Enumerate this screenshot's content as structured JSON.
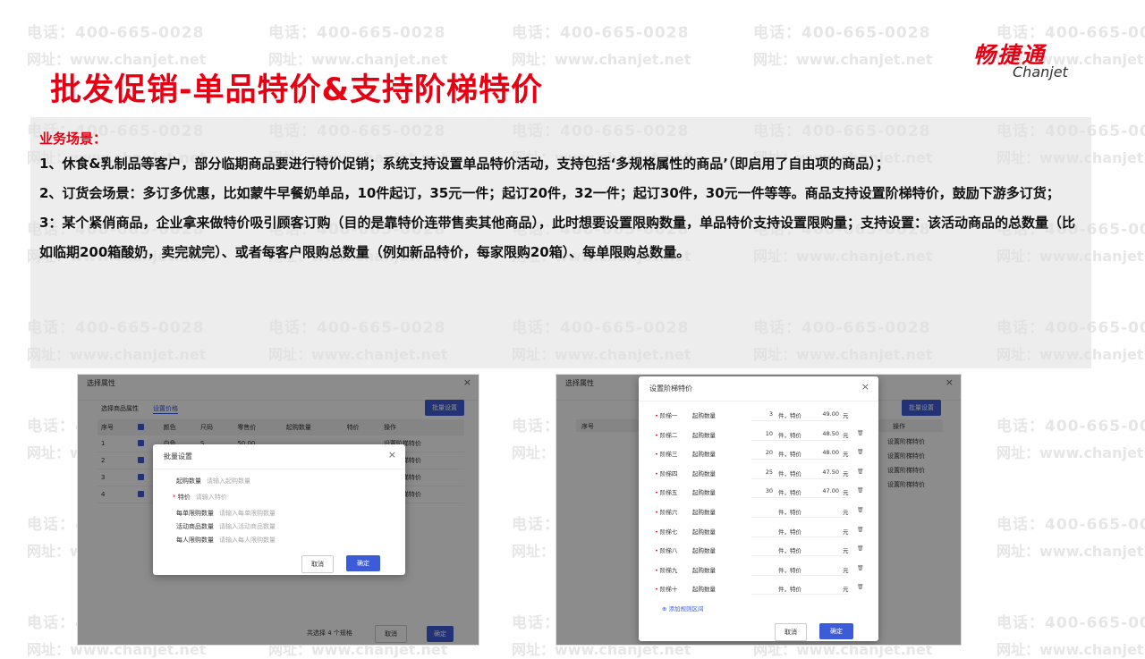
{
  "title": "批发促销-单品特价&支持阶梯特价",
  "logo": {
    "cn": "畅捷通",
    "en": "Chanjet"
  },
  "watermark": {
    "line1": "电话：400-665-0028",
    "line2": "网址：www.chanjet.net"
  },
  "scenario": {
    "heading": "业务场景：",
    "lines": [
      "1、休食&乳制品等客户，部分临期商品要进行特价促销；系统支持设置单品特价活动，支持包括‘多规格属性的商品’（即启用了自由项的商品）；",
      "2、订货会场景：多订多优惠，比如蒙牛早餐奶单品，10件起订，35元一件；起订20件，32一件；起订30件，30元一件等等。商品支持设置阶梯特价，鼓励下游多订货；",
      "3：某个紧俏商品，企业拿来做特价吸引顾客订购（目的是靠特价连带售卖其他商品），此时想要设置限购数量，单品特价支持设置限购量；支持设置：该活动商品的总数量（比如临期200箱酸奶，卖完就完）、或者每客户限购总数量（例如新品特价，每家限购20箱）、每单限购总数量。"
    ]
  },
  "left_screenshot": {
    "window_title": "选择属性",
    "tabs": [
      "选择商品属性",
      "设置价格"
    ],
    "batch_button": "批量设置",
    "columns": [
      "序号",
      "颜色",
      "尺码",
      "零售价",
      "起购数量",
      "特价",
      "操作"
    ],
    "rows": [
      {
        "no": "1",
        "color": "白色",
        "size": "S",
        "price": "50.00"
      },
      {
        "no": "2",
        "color": "",
        "size": "",
        "price": ""
      },
      {
        "no": "3",
        "color": "",
        "size": "",
        "price": ""
      },
      {
        "no": "4",
        "color": "",
        "size": "",
        "price": ""
      }
    ],
    "row_op": "设置阶梯特价",
    "footer_count": "共选择 4 个规格",
    "cancel": "取消",
    "confirm": "确定",
    "dialog": {
      "title": "批量设置",
      "fields": [
        {
          "label": "起购数量",
          "placeholder": "请输入起购数量",
          "required": false
        },
        {
          "label": "特价",
          "placeholder": "请输入特价",
          "required": true
        },
        {
          "label": "每单限购数量",
          "placeholder": "请输入每单限购数量",
          "required": false
        },
        {
          "label": "活动商品数量",
          "placeholder": "请输入活动商品数量",
          "required": false
        },
        {
          "label": "每人限购数量",
          "placeholder": "请输入每人限购数量",
          "required": false
        }
      ],
      "cancel": "取消",
      "confirm": "确定"
    }
  },
  "right_screenshot": {
    "window_title": "选择属性",
    "batch_button": "批量设置",
    "columns": [
      "序号",
      "操作"
    ],
    "row_op": "设置阶梯特价",
    "dialog": {
      "title": "设置阶梯特价",
      "qty_label": "起购数量",
      "tiers": [
        {
          "name": "阶梯一",
          "qty": "3",
          "price": "49.00"
        },
        {
          "name": "阶梯二",
          "qty": "10",
          "price": "48.50"
        },
        {
          "name": "阶梯三",
          "qty": "20",
          "price": "48.00"
        },
        {
          "name": "阶梯四",
          "qty": "25",
          "price": "47.50"
        },
        {
          "name": "阶梯五",
          "qty": "30",
          "price": "47.00"
        },
        {
          "name": "阶梯六",
          "qty": "",
          "price": ""
        },
        {
          "name": "阶梯七",
          "qty": "",
          "price": ""
        },
        {
          "name": "阶梯八",
          "qty": "",
          "price": ""
        },
        {
          "name": "阶梯九",
          "qty": "",
          "price": ""
        },
        {
          "name": "阶梯十",
          "qty": "",
          "price": ""
        }
      ],
      "unit_text": "件，特价",
      "currency": "元",
      "add_link": "添加规则区间",
      "cancel": "取消",
      "confirm": "确定"
    }
  }
}
